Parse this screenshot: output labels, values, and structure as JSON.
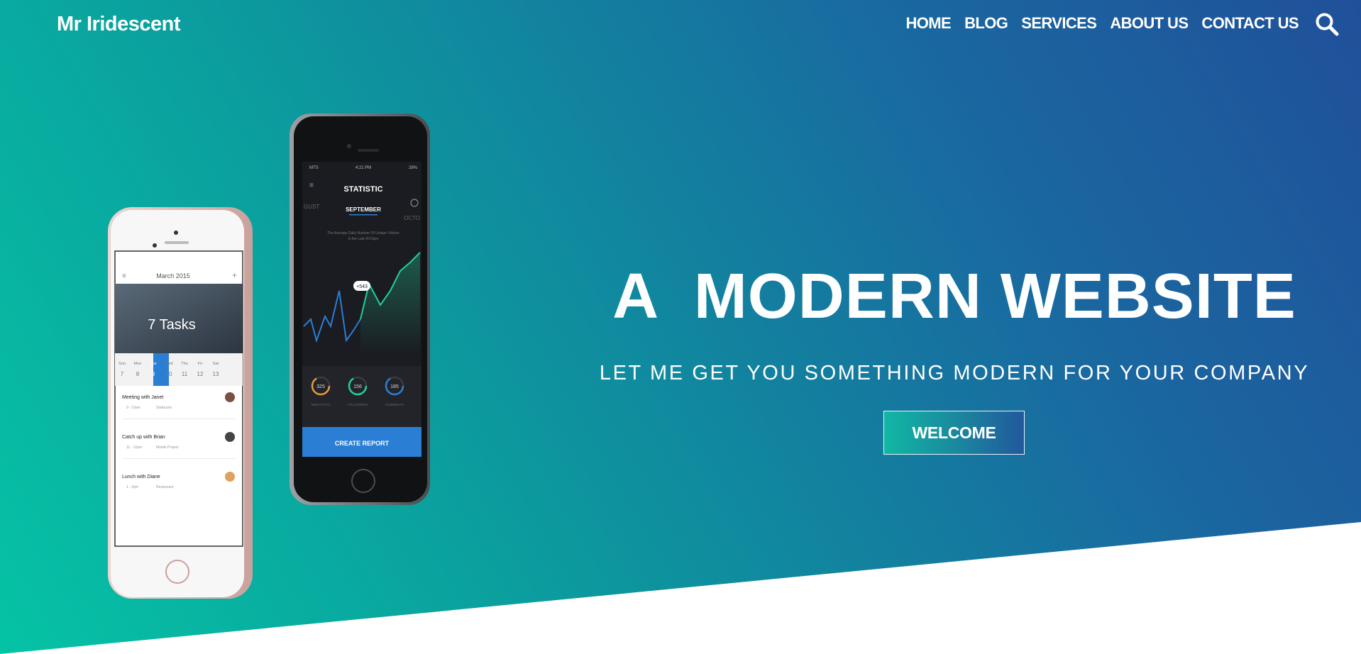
{
  "header": {
    "brand": "Mr Iridescent",
    "nav": [
      "HOME",
      "BLOG",
      "SERVICES",
      "ABOUT US",
      "CONTACT US"
    ],
    "search_icon": "search-icon"
  },
  "hero": {
    "headline": "A  MODERN WEBSITE",
    "tagline": "LET ME GET YOU SOMETHING MODERN FOR YOUR COMPANY",
    "cta": "WELCOME"
  },
  "phone_light": {
    "month": "March 2015",
    "tasks": "7 Tasks",
    "days": [
      {
        "name": "Sun",
        "num": "7"
      },
      {
        "name": "Mon",
        "num": "8"
      },
      {
        "name": "Tue",
        "num": "9"
      },
      {
        "name": "Wed",
        "num": "10"
      },
      {
        "name": "Thu",
        "num": "11"
      },
      {
        "name": "Fri",
        "num": "12"
      },
      {
        "name": "Sat",
        "num": "13"
      }
    ],
    "events": [
      {
        "title": "Meeting with Janet",
        "time": "9 - 10am",
        "place": "Starbucks"
      },
      {
        "title": "Catch up with Brian",
        "time": "11 - 12pm",
        "place": "Mobile Project"
      },
      {
        "title": "Lunch with Diane",
        "time": "1 - 2pm",
        "place": "Restaurant"
      }
    ]
  },
  "phone_dark": {
    "status_left": "MTS",
    "time": "4:21 PM",
    "battery": "28%",
    "title": "STATISTIC",
    "month_prev": "GUST",
    "month": "SEPTEMBER",
    "month_next": "OCTO",
    "caption_1": "The Average Daily Number Of Unique Visitors",
    "caption_2": "in the Last 30 Days",
    "callout": "+543",
    "stats": [
      {
        "value": "325",
        "label": "NEW POSTS"
      },
      {
        "value": "156",
        "label": "FOLLOWERS"
      },
      {
        "value": "185",
        "label": "COMMENTS"
      }
    ],
    "button": "CREATE REPORT"
  },
  "colors": {
    "gradient_start": "#06c3a5",
    "gradient_end": "#20509a",
    "accent_blue": "#2a7fd4"
  }
}
